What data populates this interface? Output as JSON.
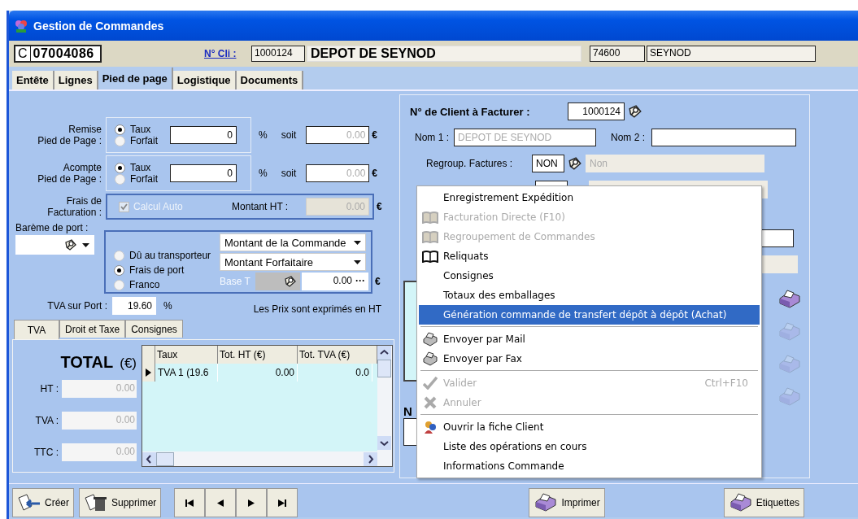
{
  "window": {
    "title": "Gestion de Commandes"
  },
  "header": {
    "order_type": "C",
    "order_number": "07004086",
    "client_link": "N° Cli :",
    "client_code": "1000124",
    "client_name": "DEPOT DE SEYNOD",
    "postcode": "74600",
    "city": "SEYNOD"
  },
  "tabs": [
    {
      "label": "Entête",
      "selected": false
    },
    {
      "label": "Lignes",
      "selected": false
    },
    {
      "label": "Pied de page",
      "selected": true
    },
    {
      "label": "Logistique",
      "selected": false
    },
    {
      "label": "Documents",
      "selected": false
    }
  ],
  "remise": {
    "label": "Remise\nPied de Page :",
    "options": [
      {
        "label": "Taux",
        "selected": true
      },
      {
        "label": "Forfait",
        "selected": false
      }
    ],
    "value": "0",
    "unit": "%",
    "soit": "soit",
    "amount": {
      "text": "0.00",
      "disabled": true
    },
    "currency": "€"
  },
  "acompte": {
    "label": "Acompte\nPied de Page :",
    "options": [
      {
        "label": "Taux",
        "selected": true
      },
      {
        "label": "Forfait",
        "selected": false
      }
    ],
    "value": "0",
    "unit": "%",
    "soit": "soit",
    "amount": {
      "text": "0.00",
      "disabled": true
    },
    "currency": "€"
  },
  "frais_facturation": {
    "label": "Frais de\nFacturation :",
    "calcul_auto": {
      "label": "Calcul Auto",
      "checked": true,
      "disabled": true
    },
    "montant_label": "Montant HT :",
    "montant": {
      "text": "0.00",
      "disabled": true
    },
    "currency": "€"
  },
  "port": {
    "bareme_label": "Barème de port :",
    "options": [
      {
        "label": "Dû au transporteur",
        "selected": false
      },
      {
        "label": "Frais de port",
        "selected": true
      },
      {
        "label": "Franco",
        "selected": false
      }
    ],
    "dropdowns": [
      "Montant de la Commande",
      "Montant Forfaitaire"
    ],
    "base_label": "Base T",
    "amount": "0.00",
    "more": "···",
    "currency": "€"
  },
  "tva_port": {
    "label": "TVA sur Port :",
    "value": "19.60",
    "unit": "%"
  },
  "price_note": "Les Prix sont exprimés en HT",
  "subtabs": [
    {
      "label": "TVA",
      "selected": true
    },
    {
      "label": "Droit et Taxe",
      "selected": false
    },
    {
      "label": "Consignes",
      "selected": false
    }
  ],
  "totals": {
    "title": "TOTAL",
    "unit": "(€)",
    "rows": [
      {
        "label": "HT :",
        "value": "0.00",
        "disabled": true
      },
      {
        "label": "TVA :",
        "value": "0.00",
        "disabled": true
      },
      {
        "label": "TTC :",
        "value": "0.00",
        "disabled": true
      }
    ]
  },
  "vat_table": {
    "columns": [
      "Taux",
      "Tot. HT (€)",
      "Tot. TVA (€)"
    ],
    "rows": [
      {
        "cells": [
          "TVA 1 (19.6",
          "0.00",
          "0.0"
        ],
        "selected": true
      }
    ]
  },
  "billing": {
    "client_label": "N° de Client à Facturer :",
    "client_code": "1000124",
    "nom1_label": "Nom 1 :",
    "nom1": {
      "text": "DEPOT DE SEYNOD",
      "disabled": true
    },
    "nom2_label": "Nom 2 :",
    "regroup_label": "Regroup. Factures :",
    "regroup_code": "NON",
    "regroup_text": {
      "text": "Non",
      "disabled": true
    },
    "lower_label": "N"
  },
  "context_menu": {
    "items": [
      {
        "kind": "plain",
        "label": "Enregistrement Expédition",
        "disabled": false,
        "selected": false
      },
      {
        "kind": "book",
        "label": "Facturation Directe (F10)",
        "disabled": true,
        "selected": false
      },
      {
        "kind": "book",
        "label": "Regroupement de Commandes",
        "disabled": true,
        "selected": false
      },
      {
        "kind": "book",
        "label": "Reliquats",
        "disabled": false,
        "selected": false
      },
      {
        "kind": "plain",
        "label": "Consignes",
        "disabled": false,
        "selected": false
      },
      {
        "kind": "plain",
        "label": "Totaux des emballages",
        "disabled": false,
        "selected": false
      },
      {
        "kind": "plain",
        "label": "Génération commande de transfert dépôt à dépôt (Achat)",
        "disabled": false,
        "selected": true
      },
      {
        "kind": "separator"
      },
      {
        "kind": "send",
        "label": "Envoyer par Mail",
        "disabled": false,
        "selected": false
      },
      {
        "kind": "send",
        "label": "Envoyer par Fax",
        "disabled": false,
        "selected": false
      },
      {
        "kind": "separator"
      },
      {
        "kind": "check",
        "label": "Valider",
        "shortcut": "Ctrl+F10",
        "disabled": true,
        "selected": false
      },
      {
        "kind": "cross",
        "label": "Annuler",
        "disabled": true,
        "selected": false
      },
      {
        "kind": "separator"
      },
      {
        "kind": "client",
        "label": "Ouvrir la fiche Client",
        "disabled": false,
        "selected": false
      },
      {
        "kind": "plain",
        "label": "Liste des opérations en cours",
        "disabled": false,
        "selected": false
      },
      {
        "kind": "plain",
        "label": "Informations Commande",
        "disabled": false,
        "selected": false
      }
    ]
  },
  "buttons": {
    "create": "Créer",
    "delete": "Supprimer",
    "print": "Imprimer",
    "labels": "Etiquettes"
  }
}
